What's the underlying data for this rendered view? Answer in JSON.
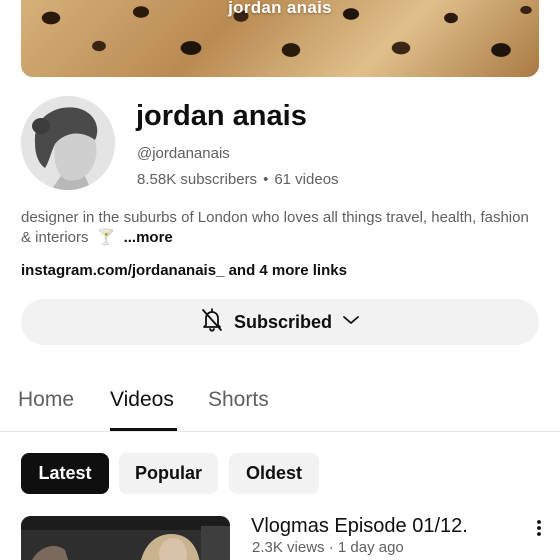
{
  "banner": {
    "title": "jordan anais"
  },
  "channel": {
    "name": "jordan anais",
    "handle": "@jordananais",
    "subscribers": "8.58K subscribers",
    "separator": "•",
    "videos": "61 videos"
  },
  "description": {
    "text": "designer in the suburbs of London who loves all things travel, health, fashion & interiors",
    "emoji": "🍸",
    "more_label": "...more"
  },
  "links": {
    "primary": "instagram.com/jordananais_",
    "more": " and 4 more links"
  },
  "subscribe_button": {
    "label": "Subscribed",
    "bell_icon": "bell-off-icon",
    "chevron_icon": "chevron-down-icon"
  },
  "tabs": [
    {
      "label": "Home",
      "active": false
    },
    {
      "label": "Videos",
      "active": true
    },
    {
      "label": "Shorts",
      "active": false
    }
  ],
  "filters": [
    {
      "label": "Latest",
      "active": true
    },
    {
      "label": "Popular",
      "active": false
    },
    {
      "label": "Oldest",
      "active": false
    }
  ],
  "video": {
    "title": "Vlogmas Episode 01/12.",
    "views": "2.3K views",
    "separator": "·",
    "age": "1 day ago"
  }
}
